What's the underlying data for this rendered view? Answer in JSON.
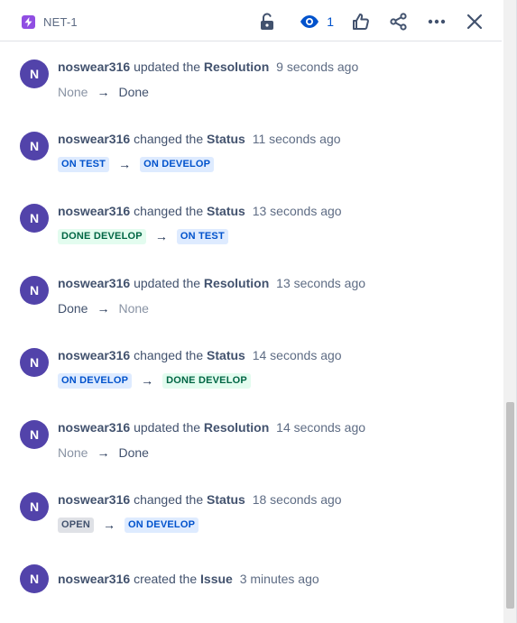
{
  "header": {
    "issue_key": "NET-1",
    "issue_type_icon": "lightning-icon",
    "watch_count": "1",
    "accent": "#0052cc",
    "issue_type_color": "#904ee2",
    "toolbar_icons": [
      "lock-open-icon",
      "eye-icon",
      "thumbs-up-icon",
      "share-icon",
      "more-icon",
      "close-icon"
    ]
  },
  "history": [
    {
      "avatar": "N",
      "user": "noswear316",
      "action": "updated the",
      "field": "Resolution",
      "time": "9 seconds ago",
      "from": "None",
      "to": "Done"
    },
    {
      "avatar": "N",
      "user": "noswear316",
      "action": "changed the",
      "field": "Status",
      "time": "11 seconds ago",
      "from": "ON TEST",
      "to": "ON DEVELOP"
    },
    {
      "avatar": "N",
      "user": "noswear316",
      "action": "changed the",
      "field": "Status",
      "time": "13 seconds ago",
      "from": "DONE DEVELOP",
      "to": "ON TEST"
    },
    {
      "avatar": "N",
      "user": "noswear316",
      "action": "updated the",
      "field": "Resolution",
      "time": "13 seconds ago",
      "from": "Done",
      "to": "None"
    },
    {
      "avatar": "N",
      "user": "noswear316",
      "action": "changed the",
      "field": "Status",
      "time": "14 seconds ago",
      "from": "ON DEVELOP",
      "to": "DONE DEVELOP"
    },
    {
      "avatar": "N",
      "user": "noswear316",
      "action": "updated the",
      "field": "Resolution",
      "time": "14 seconds ago",
      "from": "None",
      "to": "Done"
    },
    {
      "avatar": "N",
      "user": "noswear316",
      "action": "changed the",
      "field": "Status",
      "time": "18 seconds ago",
      "from": "OPEN",
      "to": "ON DEVELOP"
    },
    {
      "avatar": "N",
      "user": "noswear316",
      "action": "created the",
      "field": "Issue",
      "time": "3 minutes ago"
    }
  ],
  "arrow": "→",
  "colors": {
    "avatar": "#5243aa",
    "status_in_progress": "#deebff",
    "status_done": "#e3fcef",
    "status_todo": "#dfe1e6"
  }
}
